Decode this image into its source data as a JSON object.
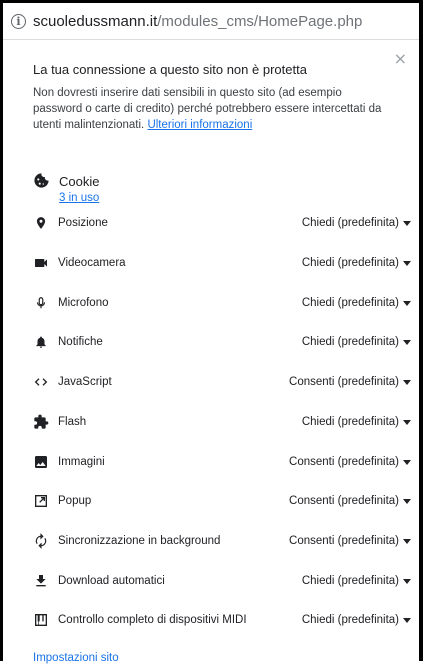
{
  "address_bar": {
    "host": "scuoledussmann.it",
    "path": "/modules_cms/HomePage.php"
  },
  "security_panel": {
    "title": "La tua connessione a questo sito non è protetta",
    "body": "Non dovresti inserire dati sensibili in questo sito (ad esempio password o carte di credito) perché potrebbero essere intercettati da utenti malintenzionati.",
    "learn_more": "Ulteriori informazioni",
    "close_symbol": "×"
  },
  "cookies": {
    "label": "Cookie",
    "in_use": "3 in uso"
  },
  "permissions": [
    {
      "name": "Posizione",
      "value": "Chiedi (predefinita)",
      "icon": "location-pin-icon"
    },
    {
      "name": "Videocamera",
      "value": "Chiedi (predefinita)",
      "icon": "videocam-icon"
    },
    {
      "name": "Microfono",
      "value": "Chiedi (predefinita)",
      "icon": "microphone-icon"
    },
    {
      "name": "Notifiche",
      "value": "Chiedi (predefinita)",
      "icon": "bell-icon"
    },
    {
      "name": "JavaScript",
      "value": "Consenti (predefinita)",
      "icon": "code-brackets-icon"
    },
    {
      "name": "Flash",
      "value": "Chiedi (predefinita)",
      "icon": "puzzle-icon"
    },
    {
      "name": "Immagini",
      "value": "Consenti (predefinita)",
      "icon": "image-icon"
    },
    {
      "name": "Popup",
      "value": "Consenti (predefinita)",
      "icon": "open-in-new-icon"
    },
    {
      "name": "Sincronizzazione in background",
      "value": "Consenti (predefinita)",
      "icon": "sync-icon"
    },
    {
      "name": "Download automatici",
      "value": "Chiedi (predefinita)",
      "icon": "download-icon"
    },
    {
      "name": "Controllo completo di dispositivi MIDI",
      "value": "Chiedi (predefinita)",
      "icon": "midi-piano-icon"
    }
  ],
  "footer": {
    "site_settings": "Impostazioni sito"
  }
}
